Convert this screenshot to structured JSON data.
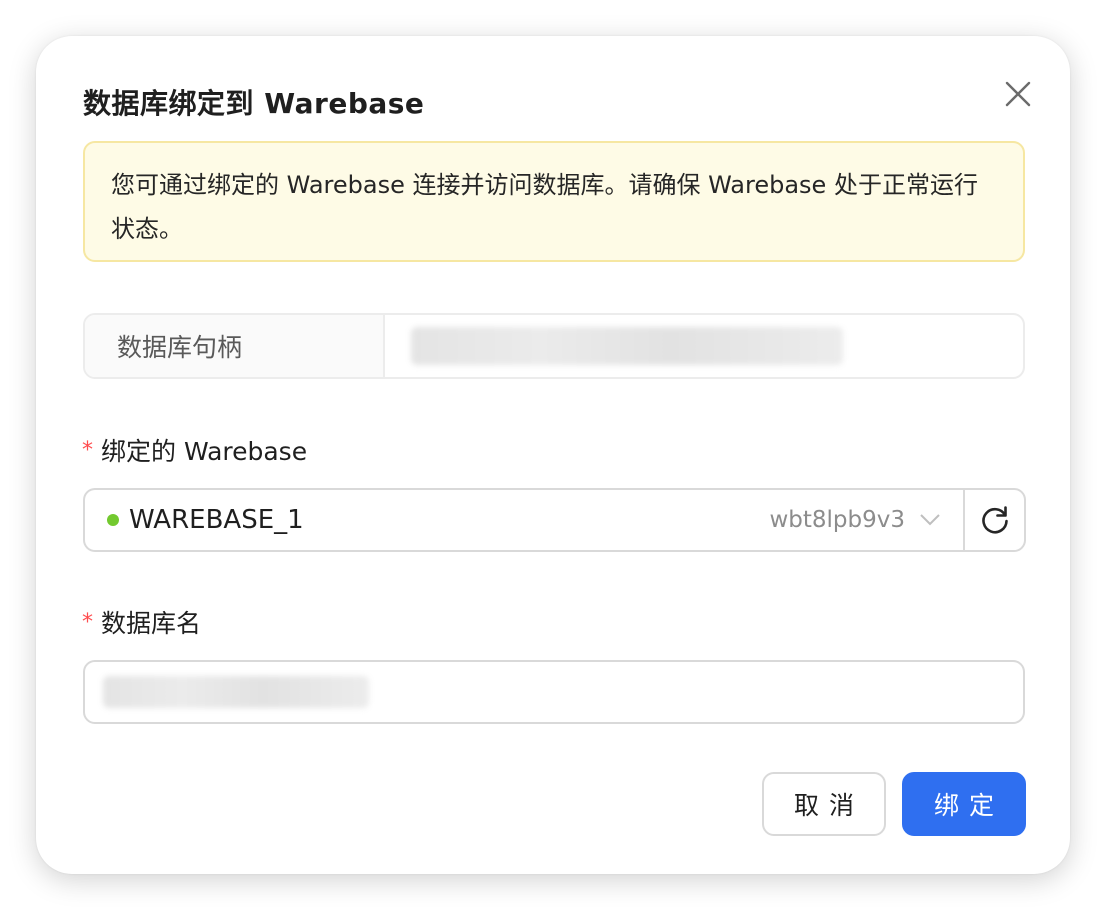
{
  "dialog": {
    "title": "数据库绑定到 Warebase",
    "close_icon": "close-icon"
  },
  "notice": {
    "text": "您可通过绑定的 Warebase 连接并访问数据库。请确保 Warebase 处于正常运行状态。"
  },
  "db_handle": {
    "label": "数据库句柄"
  },
  "warebase_field": {
    "required_mark": "*",
    "label": "绑定的 Warebase",
    "selected_value": "WAREBASE_1",
    "selected_id": "wbt8lpb9v3",
    "status_color": "#73c92f",
    "chevron_icon": "chevron-down-icon",
    "refresh_icon": "refresh-icon"
  },
  "db_name_field": {
    "required_mark": "*",
    "label": "数据库名"
  },
  "footer": {
    "cancel_label": "取消",
    "confirm_label": "绑定"
  },
  "colors": {
    "primary": "#2f6ff0",
    "notice_bg": "#fefbe6",
    "required": "#ff4d4f"
  }
}
